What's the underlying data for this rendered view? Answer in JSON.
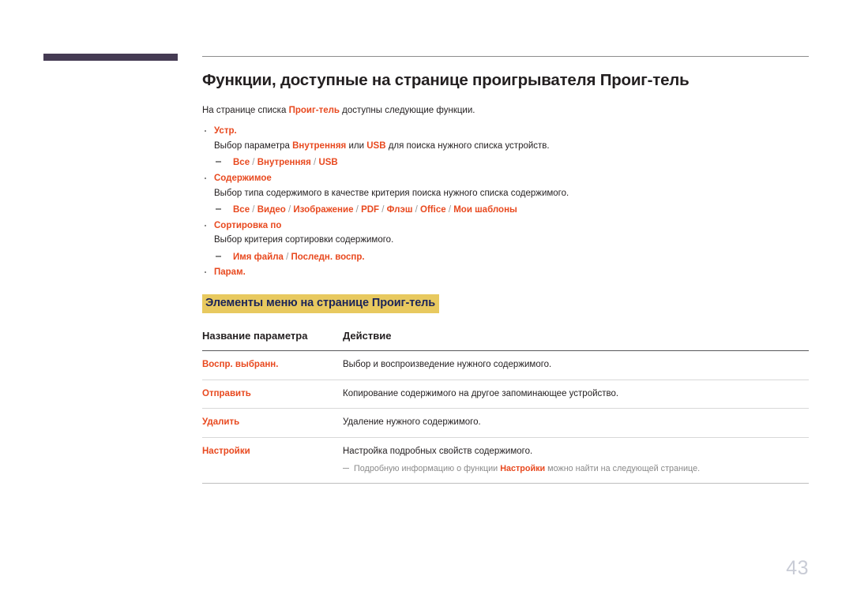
{
  "page": {
    "number": "43",
    "accent_color": "#e8491f",
    "highlight_bg": "#e8c95f",
    "highlight_fg": "#1b2458",
    "corner_bar_color": "#453b53"
  },
  "title": "Функции, доступные на странице проигрывателя Проиг-тель",
  "intro": {
    "before": "На странице списка ",
    "term": "Проиг-тель",
    "after": " доступны следующие функции."
  },
  "bullets": [
    {
      "label": "Устр.",
      "desc_parts": [
        {
          "text": "Выбор параметра ",
          "style": "plain"
        },
        {
          "text": "Внутренняя",
          "style": "accent"
        },
        {
          "text": " или ",
          "style": "plain"
        },
        {
          "text": "USB",
          "style": "accent"
        },
        {
          "text": " для поиска нужного списка устройств.",
          "style": "plain"
        }
      ],
      "options": [
        "Все",
        "Внутренняя",
        "USB"
      ]
    },
    {
      "label": "Содержимое",
      "desc_parts": [
        {
          "text": "Выбор типа содержимого в качестве критерия поиска нужного списка содержимого.",
          "style": "plain"
        }
      ],
      "options": [
        "Все",
        "Видео",
        "Изображение",
        "PDF",
        "Флэш",
        "Office",
        "Мои шаблоны"
      ]
    },
    {
      "label": "Сортировка по",
      "desc_parts": [
        {
          "text": "Выбор критерия сортировки содержимого.",
          "style": "plain"
        }
      ],
      "options": [
        "Имя файла",
        "Последн. воспр."
      ]
    },
    {
      "label": "Парам.",
      "desc_parts": [],
      "options": []
    }
  ],
  "section_heading": "Элементы меню на странице Проиг-тель",
  "table": {
    "headers": [
      "Название параметра",
      "Действие"
    ],
    "rows": [
      {
        "name": "Воспр. выбранн.",
        "action": "Выбор и воспроизведение нужного содержимого.",
        "note": null
      },
      {
        "name": "Отправить",
        "action": "Копирование содержимого на другое запоминающее устройство.",
        "note": null
      },
      {
        "name": "Удалить",
        "action": "Удаление нужного содержимого.",
        "note": null
      },
      {
        "name": "Настройки",
        "action": "Настройка подробных свойств содержимого.",
        "note": {
          "before": "Подробную информацию о функции ",
          "term": "Настройки",
          "after": " можно найти на следующей странице."
        }
      }
    ]
  }
}
